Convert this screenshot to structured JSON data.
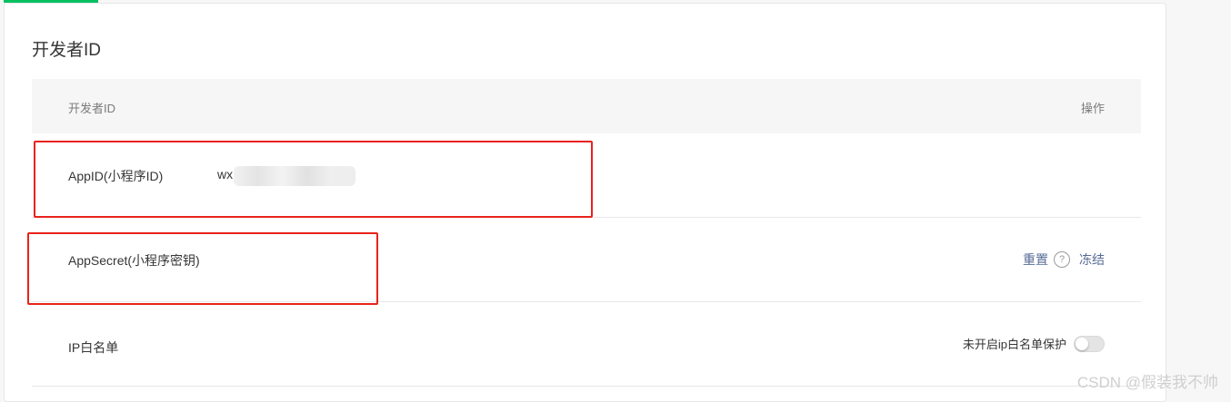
{
  "section_title": "开发者ID",
  "table": {
    "header": {
      "col_id": "开发者ID",
      "col_action": "操作"
    },
    "rows": {
      "appid": {
        "label": "AppID(小程序ID)",
        "value_prefix": "wx"
      },
      "appsecret": {
        "label": "AppSecret(小程序密钥)",
        "reset_label": "重置",
        "help_icon": "?",
        "freeze_label": "冻结"
      },
      "ip_whitelist": {
        "label": "IP白名单",
        "status_text": "未开启ip白名单保护",
        "toggle_on": false
      }
    }
  },
  "watermark": "CSDN @假装我不帅",
  "colors": {
    "accent": "#07c160",
    "link": "#576b95",
    "highlight_box": "#e8231a"
  }
}
